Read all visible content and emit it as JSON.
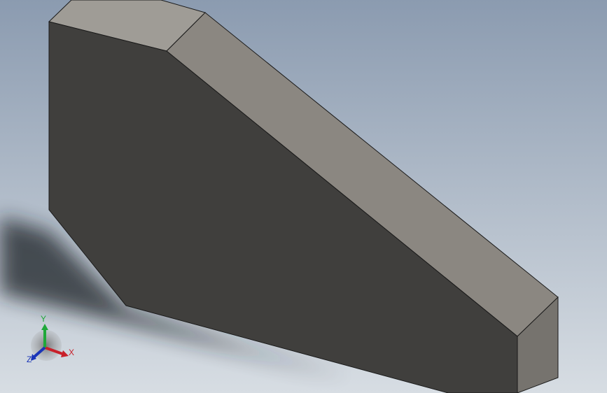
{
  "viewport": {
    "background_top": "#8b9bb0",
    "background_bottom": "#d7dde3"
  },
  "part": {
    "front_face_color": "#403f3d",
    "top_face_color": "#9f9c96",
    "sloped_face_color": "#8b8781",
    "end_face_color": "#76736e",
    "edge_color": "#1a1a1a",
    "shadow_color": "#1f2326"
  },
  "triad": {
    "x_label": "X",
    "y_label": "Y",
    "z_label": "Z",
    "x_color": "#c8202a",
    "y_color": "#1fa83a",
    "z_color": "#1a34b8"
  }
}
